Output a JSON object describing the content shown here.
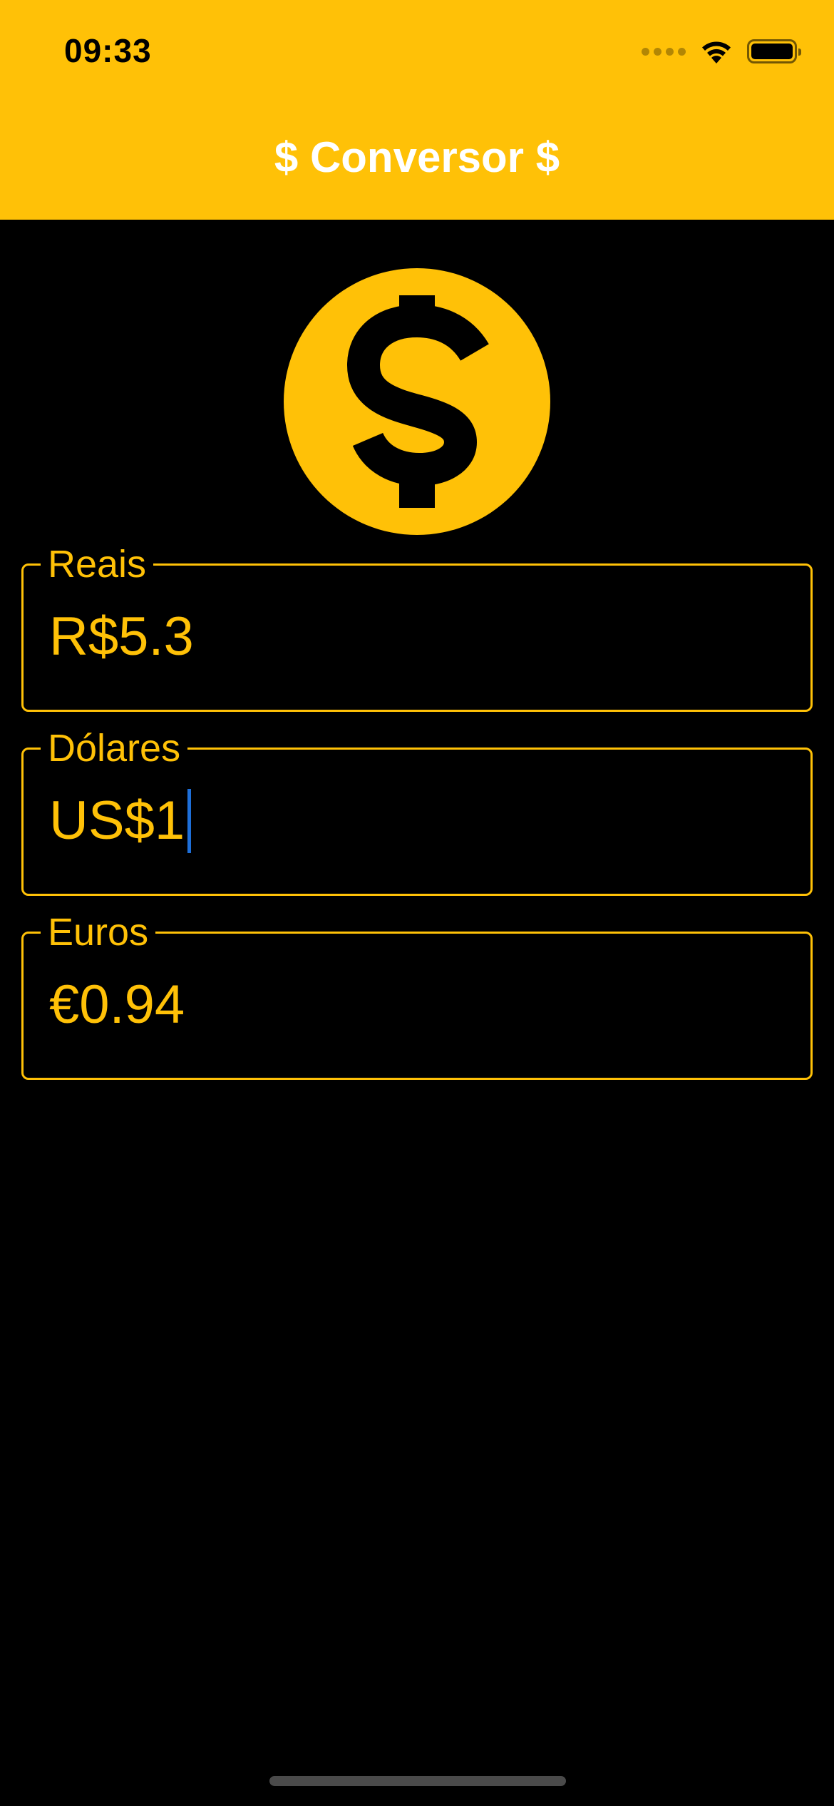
{
  "status_bar": {
    "time": "09:33",
    "icons": [
      "cellular-dots-icon",
      "wifi-icon",
      "battery-icon"
    ]
  },
  "app_bar": {
    "title": "$ Conversor $",
    "background_color": "#FFC107",
    "title_color": "#FFFFFF"
  },
  "logo": {
    "icon": "dollar-coin-icon",
    "color": "#FFC107"
  },
  "fields": {
    "reais": {
      "label": "Reais",
      "value": "R$5.3"
    },
    "dolares": {
      "label": "Dólares",
      "value": "US$1",
      "focused": true
    },
    "euros": {
      "label": "Euros",
      "value": "€0.94"
    }
  },
  "theme": {
    "accent": "#FFC107",
    "background": "#000000",
    "caret": "#1E6FD9"
  }
}
